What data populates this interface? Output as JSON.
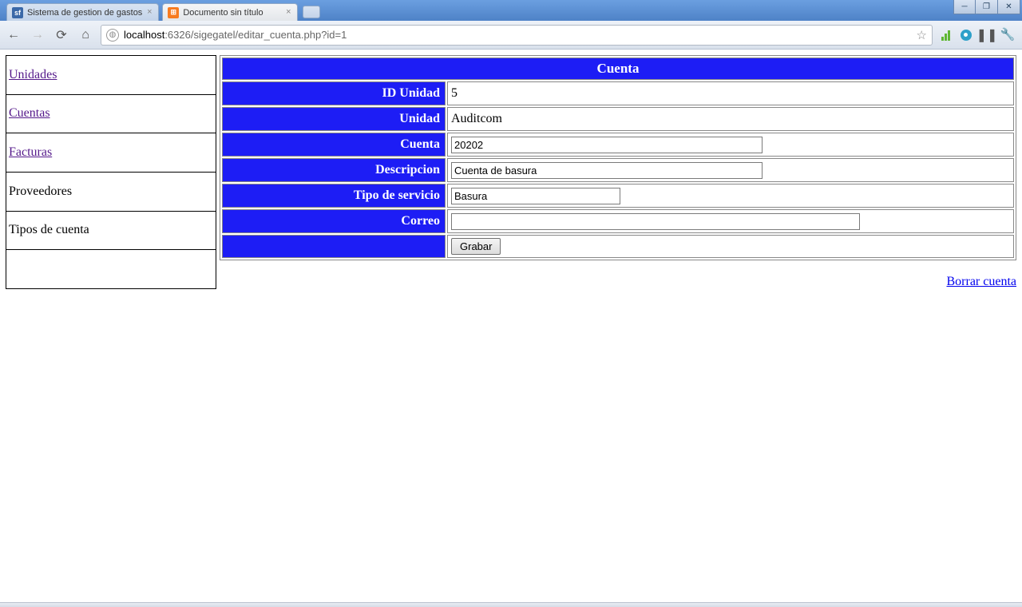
{
  "chrome": {
    "tabs": [
      {
        "title": "Sistema de gestion de gastos",
        "fav": "sf"
      },
      {
        "title": "Documento sin título",
        "fav": "x"
      }
    ],
    "url_host": "localhost",
    "url_rest": ":6326/sigegatel/editar_cuenta.php?id=1"
  },
  "sidebar": {
    "items": [
      {
        "label": "Unidades",
        "link": true
      },
      {
        "label": "Cuentas",
        "link": true
      },
      {
        "label": "Facturas",
        "link": true
      },
      {
        "label": "Proveedores",
        "link": false
      },
      {
        "label": "Tipos de cuenta",
        "link": false
      },
      {
        "label": "",
        "link": false
      }
    ]
  },
  "form": {
    "header": "Cuenta",
    "rows": {
      "id_unidad_label": "ID Unidad",
      "id_unidad_value": "5",
      "unidad_label": "Unidad",
      "unidad_value": "Auditcom",
      "cuenta_label": "Cuenta",
      "cuenta_value": "20202",
      "descripcion_label": "Descripcion",
      "descripcion_value": "Cuenta de basura",
      "tipo_label": "Tipo de servicio",
      "tipo_value": "Basura",
      "correo_label": "Correo",
      "correo_value": ""
    },
    "submit_label": "Grabar",
    "delete_label": "Borrar cuenta"
  }
}
